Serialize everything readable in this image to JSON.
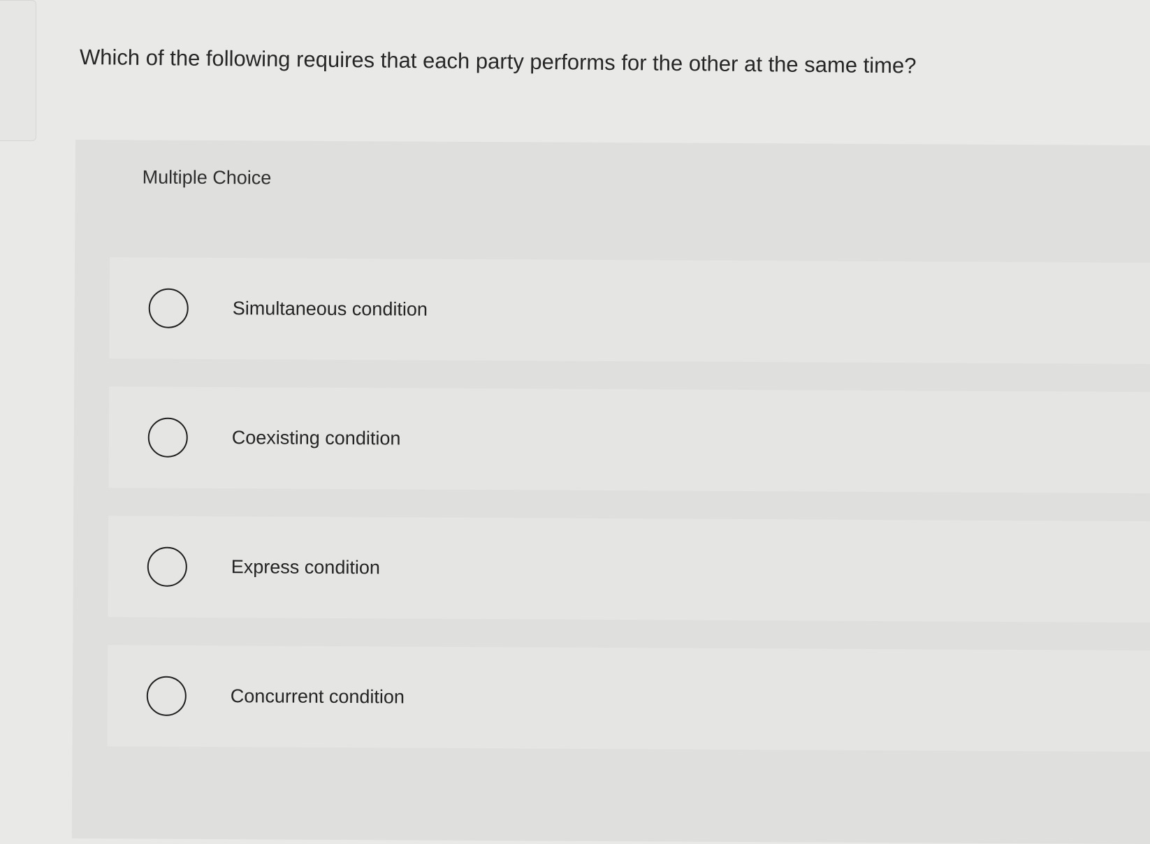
{
  "question": {
    "text": "Which of the following requires that each party performs for the other at the same time?"
  },
  "quiz": {
    "type_label": "Multiple Choice",
    "options": [
      {
        "label": "Simultaneous condition"
      },
      {
        "label": "Coexisting condition"
      },
      {
        "label": "Express condition"
      },
      {
        "label": "Concurrent condition"
      }
    ]
  }
}
